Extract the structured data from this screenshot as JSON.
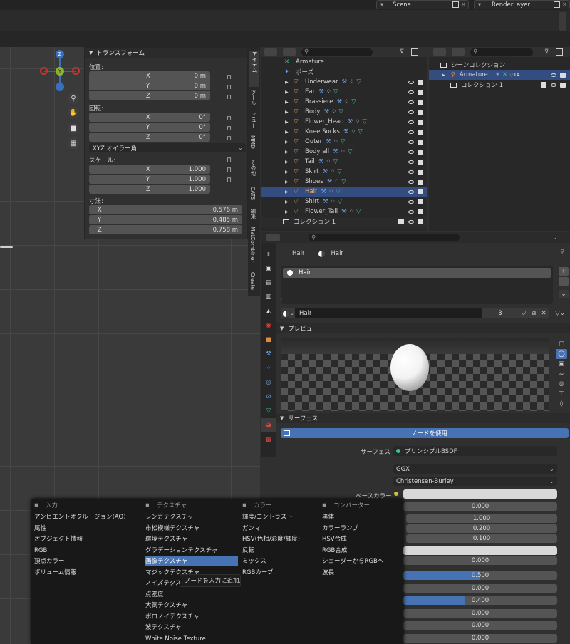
{
  "topbar": {
    "scene": "Scene",
    "render_layer": "RenderLayer"
  },
  "transform": {
    "title": "トランスフォーム",
    "location_label": "位置:",
    "location": [
      {
        "axis": "X",
        "value": "0 m"
      },
      {
        "axis": "Y",
        "value": "0 m"
      },
      {
        "axis": "Z",
        "value": "0 m"
      }
    ],
    "rotation_label": "回転:",
    "rotation": [
      {
        "axis": "X",
        "value": "0°"
      },
      {
        "axis": "Y",
        "value": "0°"
      },
      {
        "axis": "Z",
        "value": "0°"
      }
    ],
    "rotation_mode": "XYZ オイラー角",
    "scale_label": "スケール:",
    "scale": [
      {
        "axis": "X",
        "value": "1.000"
      },
      {
        "axis": "Y",
        "value": "1.000"
      },
      {
        "axis": "Z",
        "value": "1.000"
      }
    ],
    "dimensions_label": "寸法:",
    "dimensions": [
      {
        "axis": "X",
        "value": "0.576 m"
      },
      {
        "axis": "Y",
        "value": "0.485 m"
      },
      {
        "axis": "Z",
        "value": "0.758 m"
      }
    ]
  },
  "side_tabs": [
    "アイテム",
    "ツール",
    "ビュー",
    "MMD",
    "その他",
    "CATS",
    "編集",
    "MatCombiner",
    "Create"
  ],
  "gizmo": {
    "x": "X",
    "y": "Y",
    "z": "Z"
  },
  "outliner_left": {
    "items": [
      {
        "name": "Armature",
        "selected": false
      },
      {
        "name": "ポーズ",
        "selected": false
      },
      {
        "name": "Underwear",
        "selected": false
      },
      {
        "name": "Ear",
        "selected": false
      },
      {
        "name": "Brassiere",
        "selected": false
      },
      {
        "name": "Body",
        "selected": false
      },
      {
        "name": "Flower_Head",
        "selected": false
      },
      {
        "name": "Knee Socks",
        "selected": false
      },
      {
        "name": "Outer",
        "selected": false
      },
      {
        "name": "Body all",
        "selected": false
      },
      {
        "name": "Tail",
        "selected": false
      },
      {
        "name": "Skirt",
        "selected": false
      },
      {
        "name": "Shoes",
        "selected": false
      },
      {
        "name": "Hair",
        "selected": true
      },
      {
        "name": "Shirt",
        "selected": false
      },
      {
        "name": "Flower_Tail",
        "selected": false
      }
    ],
    "collection": "コレクション 1"
  },
  "outliner_right": {
    "scene_collection": "シーンコレクション",
    "armature": "Armature",
    "armature_count": "14",
    "collection": "コレクション 1"
  },
  "properties": {
    "breadcrumb_object": "Hair",
    "breadcrumb_material": "Hair",
    "material_slot": "Hair",
    "material_name": "Hair",
    "user_count": "3",
    "preview_label": "プレビュー",
    "surface_label": "サーフェス",
    "use_nodes_button": "ノードを使用",
    "surface_field_label": "サーフェス",
    "surface_shader": "プリンシプルBSDF",
    "distribution": "GGX",
    "subsurface_method": "Christensen-Burley",
    "base_color_label": "ベースカラー",
    "values": [
      "0.000",
      "1.000",
      "0.200",
      "0.100",
      "0.000",
      "0.500",
      "0.000",
      "0.400",
      "0.000",
      "0.000",
      "0.000"
    ]
  },
  "add_menu": {
    "columns": [
      {
        "title": "入力",
        "items": [
          "アンビエントオクルージョン(AO)",
          "属性",
          "オブジェクト情報",
          "RGB",
          "頂点カラー",
          "ボリューム情報"
        ]
      },
      {
        "title": "テクスチャ",
        "items": [
          "レンガテクスチャ",
          "市松模様テクスチャ",
          "環境テクスチャ",
          "グラデーションテクスチャ",
          "画像テクスチャ",
          "マジックテクスチャ",
          "ノイズテクスチャ",
          "点密度",
          "大気テクスチャ",
          "ボロノイテクスチャ",
          "波テクスチャ",
          "White Noise Texture"
        ]
      },
      {
        "title": "カラー",
        "items": [
          "輝度/コントラスト",
          "ガンマ",
          "HSV(色相/彩度/輝度)",
          "反転",
          "ミックス",
          "RGBカーブ"
        ]
      },
      {
        "title": "コンバーター",
        "items": [
          "黒体",
          "カラーランプ",
          "HSV合成",
          "RGB合成",
          "シェーダーからRGBへ",
          "波長"
        ]
      }
    ],
    "highlighted": "画像テクスチャ",
    "tooltip": "ノードを入力に追加."
  },
  "colors": {
    "accent": "#4772b3",
    "bg": "#303030",
    "panel": "#3d3d3d",
    "mesh_icon": "#e08a3c",
    "modifier_icon": "#6ea0e6",
    "material_icon": "#3fbf8f"
  }
}
